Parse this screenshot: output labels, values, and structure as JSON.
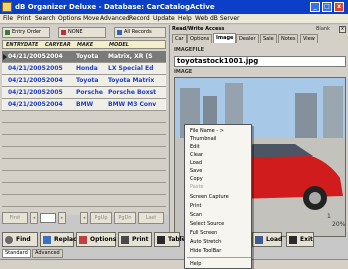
{
  "window": {
    "title": "dB Organizer Deluxe - Database: CarCatalogActive",
    "min_label": "_",
    "max_label": "□",
    "close_label": "x"
  },
  "menu": [
    "File",
    "Print",
    "Search",
    "Options",
    "Move",
    "Advanced",
    "Record",
    "Update",
    "Help",
    "Web dB Server"
  ],
  "left_toolbar": {
    "entry_order": "Entry Order",
    "none": "NONE",
    "all_records": "All Records"
  },
  "columns": [
    "ENTRYDATE",
    "CARYEAR",
    "MAKE",
    "MODEL"
  ],
  "rows": [
    {
      "date": "04/21/2005",
      "year": "2004",
      "make": "Toyota",
      "model": "Matrix, XR (S"
    },
    {
      "date": "04/21/2005",
      "year": "2005",
      "make": "Honda",
      "model": "LX Special Ed"
    },
    {
      "date": "04/21/2005",
      "year": "2004",
      "make": "Toyota",
      "model": "Toyota Matrix"
    },
    {
      "date": "04/21/2005",
      "year": "2005",
      "make": "Porsche",
      "model": "Porsche Boxst"
    },
    {
      "date": "04/21/2005",
      "year": "2004",
      "make": "BMW",
      "model": "BMW M3 Conv"
    }
  ],
  "nav": {
    "first": "First",
    "pgup": "PgUp",
    "pgdn": "PgDn",
    "last": "Last"
  },
  "bottom_buttons": {
    "find": "Find",
    "replace": "Replace",
    "options": "Options",
    "print": "Print",
    "table": "Table",
    "load": "Load",
    "exit": "Exit"
  },
  "mode_tabs": [
    "Standard",
    "Advanced"
  ],
  "right_panel": {
    "title": "Read/Write Access",
    "close": "x",
    "blank_label": "Blank",
    "tabs": [
      "Car",
      "Options",
      "Image",
      "Dealer",
      "Sale",
      "Notes",
      "View"
    ],
    "active_tab": "Image",
    "imagefile_label": "IMAGEFILE",
    "imagefile_value": "toyotastock1001.jpg",
    "image_label": "IMAGE",
    "zoom_partial": "1",
    "zoom_value": "20%"
  },
  "context_menu": [
    {
      "label": "File Name - >",
      "disabled": false
    },
    {
      "label": "Thumbnail",
      "disabled": false
    },
    {
      "label": "Edit",
      "disabled": false
    },
    {
      "label": "Clear",
      "disabled": false
    },
    {
      "label": "Load",
      "disabled": false
    },
    {
      "label": "Save",
      "disabled": false
    },
    {
      "label": "Copy",
      "disabled": false
    },
    {
      "label": "Paste",
      "disabled": true
    },
    {
      "label": "Screen Capture",
      "disabled": false
    },
    {
      "label": "Print",
      "disabled": false
    },
    {
      "label": "Scan",
      "disabled": false
    },
    {
      "label": "Select Source",
      "disabled": false
    },
    {
      "label": "Full Screen",
      "disabled": false
    },
    {
      "label": "Auto Stretch",
      "disabled": false
    },
    {
      "label": "Hide ToolBar",
      "disabled": false
    },
    {
      "label": "Help",
      "disabled": false
    }
  ],
  "icons": [
    "app-icon",
    "entry-order-icon",
    "none-icon",
    "all-records-icon",
    "find-icon",
    "replace-icon",
    "options-icon",
    "print-icon",
    "table-icon",
    "load-icon",
    "exit-icon",
    "bulb-icon"
  ]
}
